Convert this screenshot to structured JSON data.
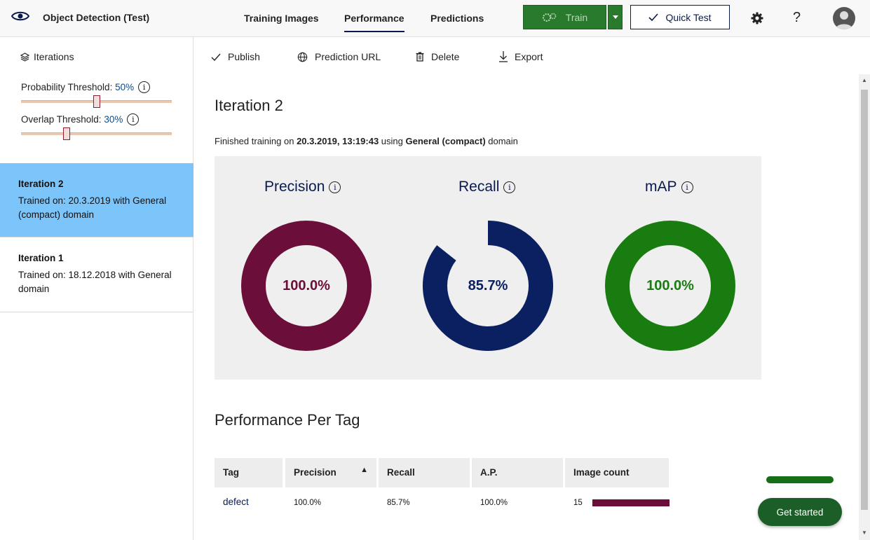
{
  "header": {
    "app_title": "Object Detection (Test)",
    "tabs": [
      {
        "label": "Training Images",
        "active": false
      },
      {
        "label": "Performance",
        "active": true
      },
      {
        "label": "Predictions",
        "active": false
      }
    ],
    "train_label": "Train",
    "quick_test_label": "Quick Test",
    "help_label": "?",
    "colors": {
      "train": "#2a7a2e",
      "accent": "#0b1a4d"
    }
  },
  "sidebar": {
    "header": "Iterations",
    "probability": {
      "label": "Probability Threshold:",
      "value": "50%",
      "level": 0.5
    },
    "overlap": {
      "label": "Overlap Threshold:",
      "value": "30%",
      "level": 0.3
    },
    "iterations": [
      {
        "name": "Iteration 2",
        "desc": "Trained on: 20.3.2019 with General (compact) domain",
        "selected": true
      },
      {
        "name": "Iteration 1",
        "desc": "Trained on: 18.12.2018 with General domain",
        "selected": false
      }
    ]
  },
  "actions": {
    "publish": "Publish",
    "prediction_url": "Prediction URL",
    "delete": "Delete",
    "export": "Export"
  },
  "main": {
    "title": "Iteration 2",
    "finished_prefix": "Finished training on ",
    "finished_date": "20.3.2019, 13:19:43",
    "finished_mid": " using ",
    "finished_domain": "General (compact)",
    "finished_suffix": " domain",
    "metrics": [
      {
        "name": "Precision",
        "value_text": "100.0%",
        "fraction": 1.0,
        "color": "#6b0f3a"
      },
      {
        "name": "Recall",
        "value_text": "85.7%",
        "fraction": 0.857,
        "color": "#0b2060"
      },
      {
        "name": "mAP",
        "value_text": "100.0%",
        "fraction": 1.0,
        "color": "#197c10"
      }
    ],
    "per_tag_title": "Performance Per Tag",
    "table": {
      "headers": [
        "Tag",
        "Precision",
        "Recall",
        "A.P.",
        "Image count"
      ],
      "sort_icon": "▲",
      "rows": [
        {
          "tag": "defect",
          "precision": "100.0%",
          "recall": "85.7%",
          "ap": "100.0%",
          "count": "15",
          "bar_color": "#6b0f3a"
        }
      ]
    }
  },
  "get_started": "Get started"
}
